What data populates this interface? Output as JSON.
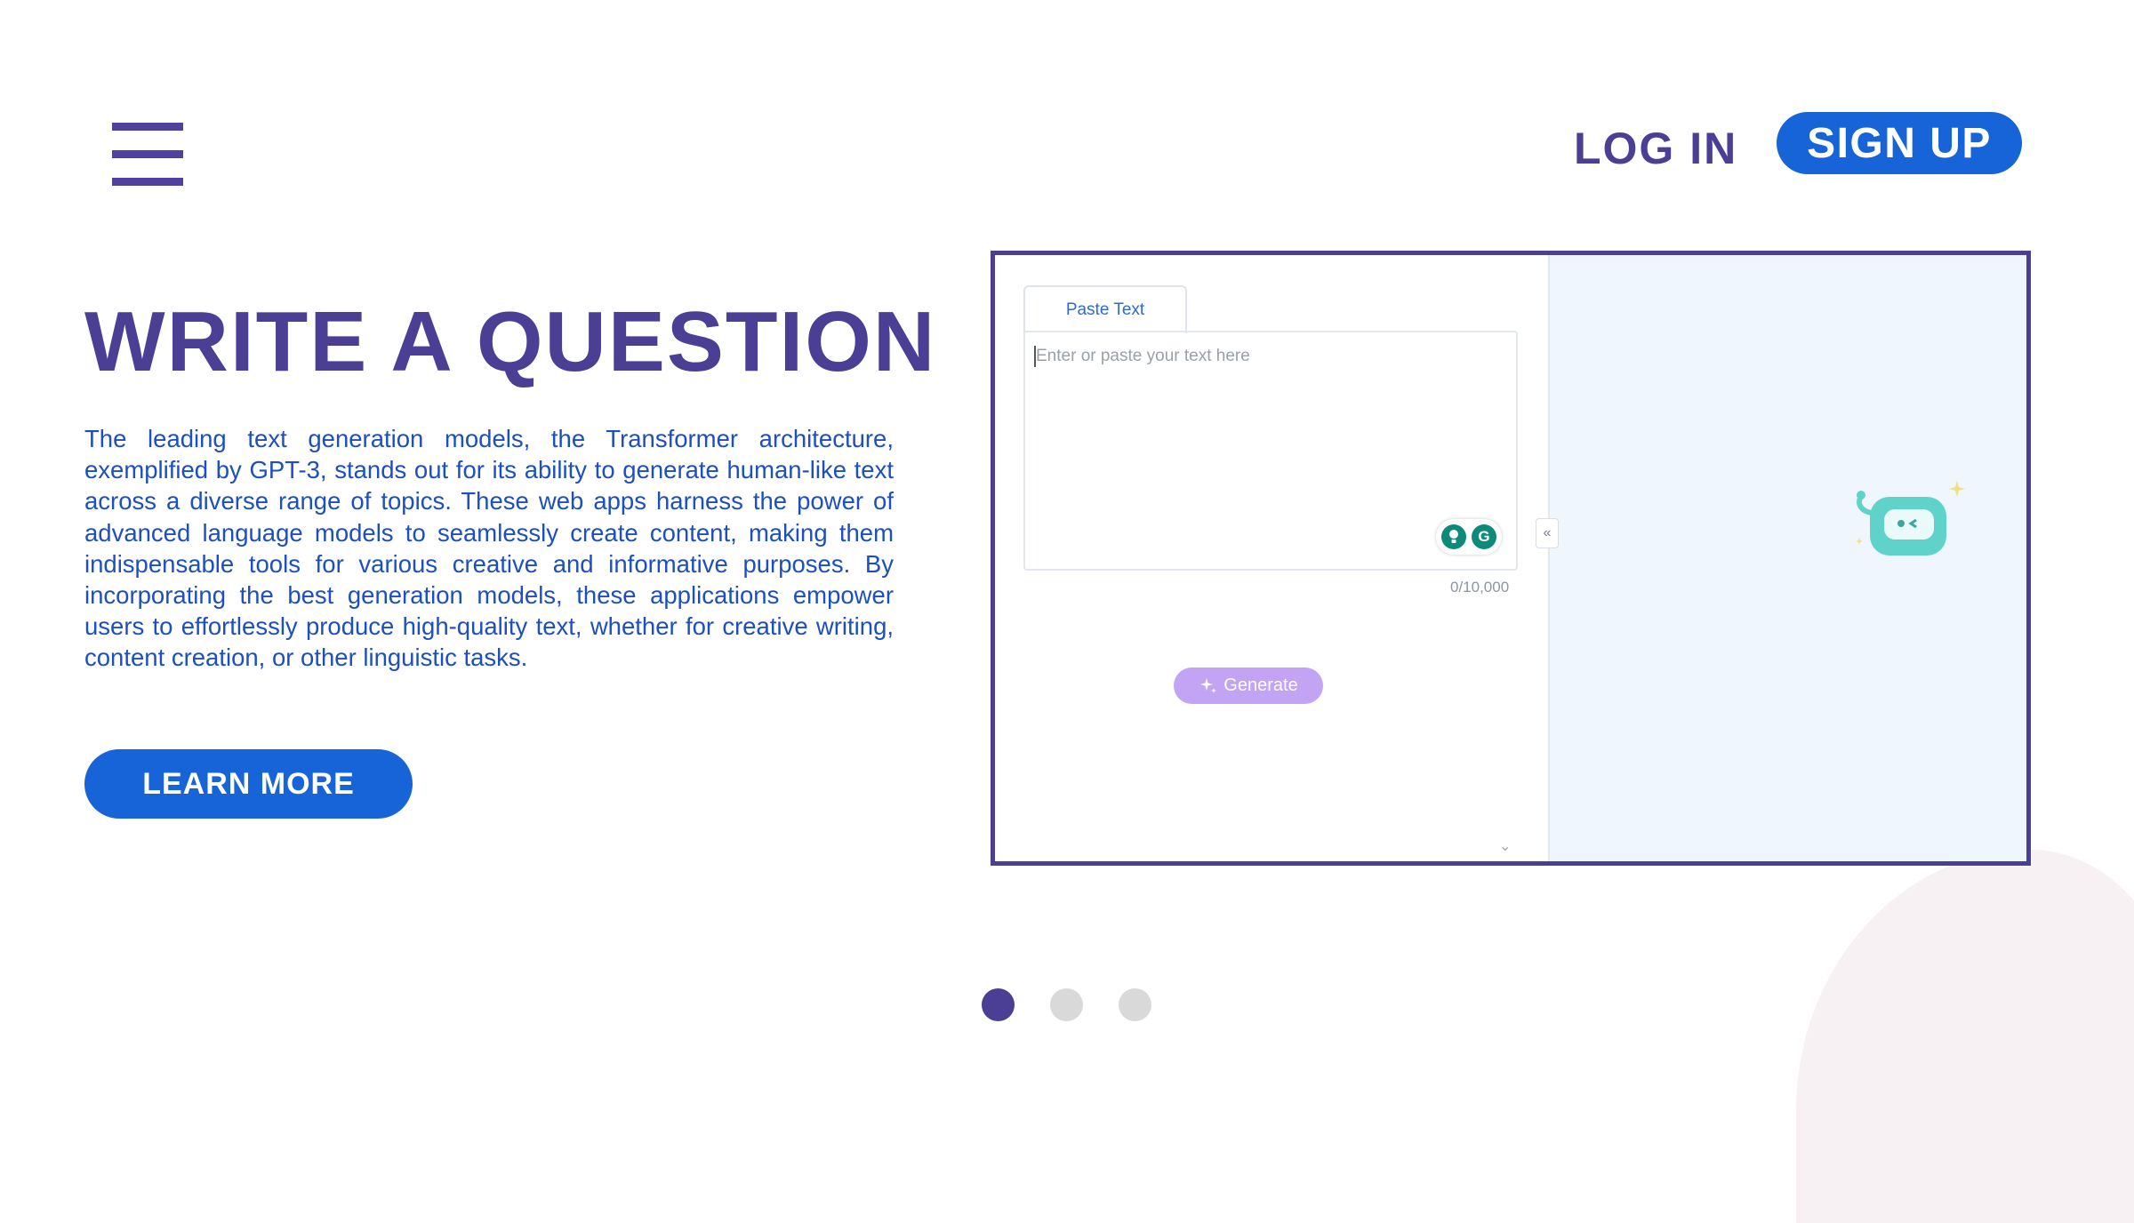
{
  "header": {
    "login_label": "LOG IN",
    "signup_label": "SIGN UP"
  },
  "hero": {
    "title": "WRITE A QUESTION",
    "description": "The leading text generation models, the Transformer architecture, exemplified by GPT-3, stands out for its ability to generate human-like text across a diverse range of topics. These web apps harness the power of advanced language models to seamlessly create content, making them indispensable tools for various creative and informative purposes. By incorporating the best generation models, these applications empower users to effortlessly produce high-quality text, whether for creative writing, content creation, or other linguistic tasks.",
    "cta_label": "LEARN MORE"
  },
  "preview": {
    "tab_label": "Paste Text",
    "input_placeholder": "Enter or paste your text here",
    "char_counter": "0/10,000",
    "generate_label": "Generate"
  },
  "carousel": {
    "slide_count": 3,
    "active_index": 0
  },
  "colors": {
    "brand_purple": "#4b3e95",
    "brand_blue": "#1664d8",
    "generate_button": "#c2a3f4",
    "robot": "#5fd3c9"
  },
  "icons": [
    "hamburger-menu-icon",
    "sparkle-icon",
    "bulb-icon",
    "grammarly-icon",
    "chevron-left-double-icon",
    "robot-assistant-icon",
    "chevron-down-icon"
  ]
}
